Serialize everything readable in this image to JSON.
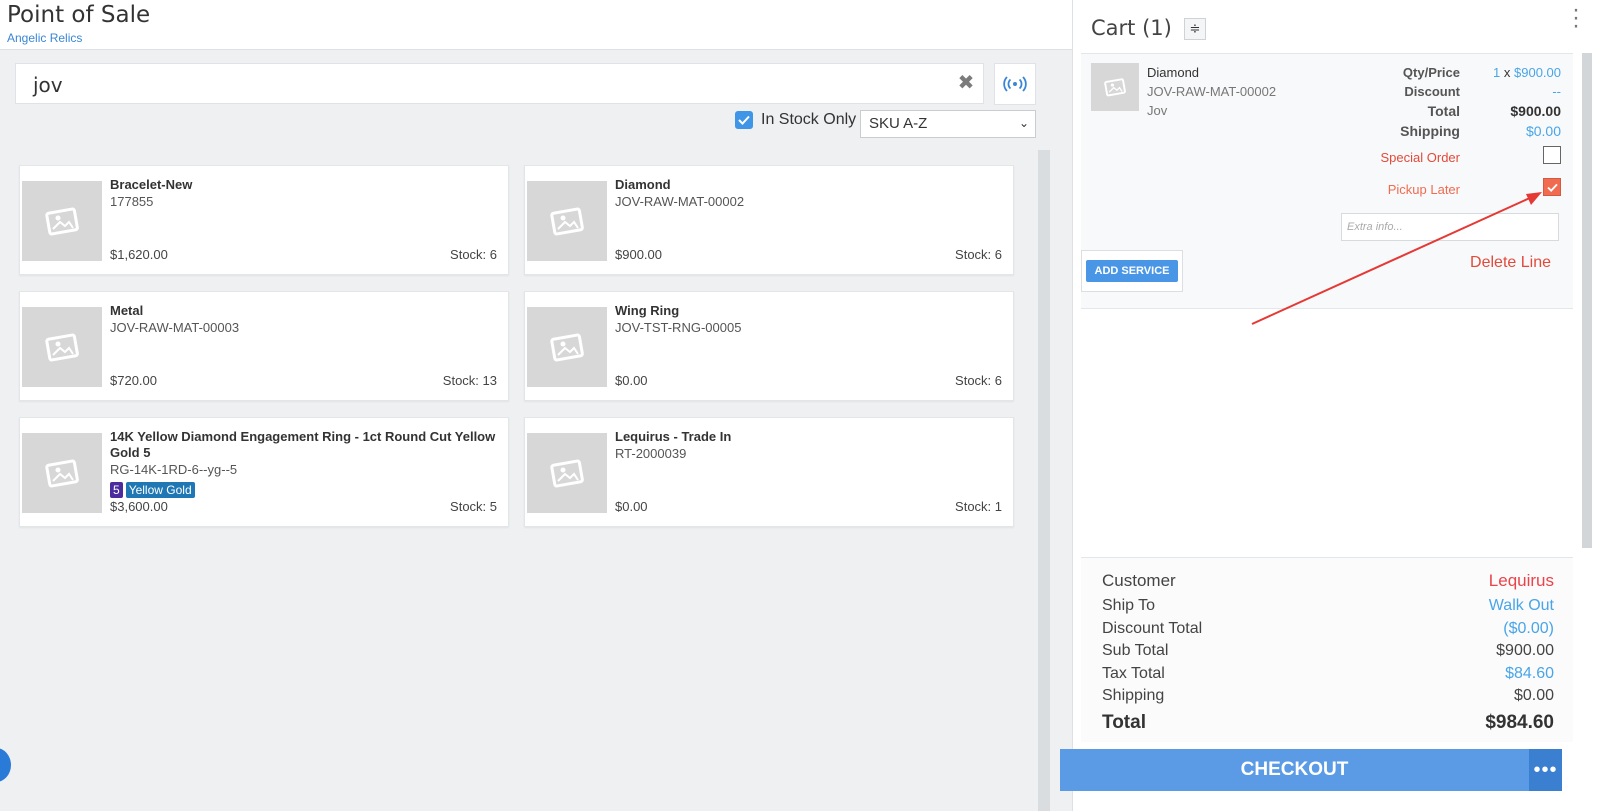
{
  "header": {
    "title": "Point of Sale",
    "subtitle": "Angelic Relics"
  },
  "search": {
    "value": "jov"
  },
  "filters": {
    "in_stock_label": "In Stock Only",
    "in_stock_checked": true,
    "sort_value": "SKU A-Z"
  },
  "products": [
    {
      "name": "Bracelet-New",
      "sku": "177855",
      "price": "$1,620.00",
      "stock": "Stock: 6"
    },
    {
      "name": "Diamond",
      "sku": "JOV-RAW-MAT-00002",
      "price": "$900.00",
      "stock": "Stock: 6"
    },
    {
      "name": "Metal",
      "sku": "JOV-RAW-MAT-00003",
      "price": "$720.00",
      "stock": "Stock: 13"
    },
    {
      "name": "Wing Ring",
      "sku": "JOV-TST-RNG-00005",
      "price": "$0.00",
      "stock": "Stock: 6"
    },
    {
      "name": "14K Yellow Diamond Engagement Ring - 1ct Round Cut Yellow Gold 5",
      "sku": "RG-14K-1RD-6--yg--5",
      "price": "$3,600.00",
      "stock": "Stock: 5",
      "badges": [
        {
          "text": "5",
          "color": "#4b2c9e"
        },
        {
          "text": "Yellow Gold",
          "color": "#1f78b4"
        }
      ]
    },
    {
      "name": "Lequirus - Trade In",
      "sku": "RT-2000039",
      "price": "$0.00",
      "stock": "Stock: 1"
    }
  ],
  "cart": {
    "title": "Cart (1)",
    "line": {
      "name": "Diamond",
      "sku": "JOV-RAW-MAT-00002",
      "brand": "Jov",
      "qty_price_label": "Qty/Price",
      "qty": "1",
      "qty_sep": "x",
      "unit_price": "$900.00",
      "discount_label": "Discount",
      "discount_value": "--",
      "total_label": "Total",
      "total_value": "$900.00",
      "shipping_label": "Shipping",
      "shipping_value": "$0.00",
      "special_order_label": "Special Order",
      "special_order_checked": false,
      "pickup_later_label": "Pickup Later",
      "pickup_later_checked": true,
      "extra_placeholder": "Extra info...",
      "add_service_label": "ADD SERVICE",
      "delete_label": "Delete Line"
    },
    "summary": {
      "customer_label": "Customer",
      "customer_value": "Lequirus",
      "ship_to_label": "Ship To",
      "ship_to_value": "Walk Out",
      "discount_total_label": "Discount Total",
      "discount_total_value": "($0.00)",
      "sub_total_label": "Sub Total",
      "sub_total_value": "$900.00",
      "tax_total_label": "Tax Total",
      "tax_total_value": "$84.60",
      "shipping_label": "Shipping",
      "shipping_value": "$0.00",
      "total_label": "Total",
      "total_value": "$984.60"
    },
    "checkout_label": "CHECKOUT"
  },
  "colors": {
    "accent": "#5b9be6",
    "danger": "#e24a3b",
    "link": "#49a5e8",
    "annotation_arrow": "#e53935"
  }
}
